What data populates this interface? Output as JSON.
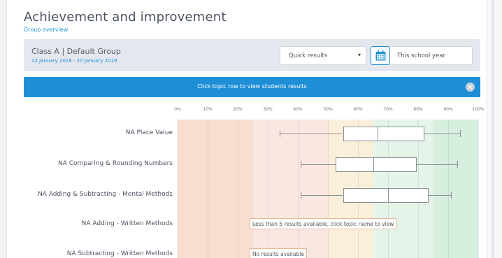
{
  "page": {
    "title": "Achievement and improvement",
    "subtitle": "Group overview"
  },
  "class_panel": {
    "name": "Class A | Default Group",
    "dates": "22 January 2018 - 20 January 2019",
    "quick_select": {
      "value": "Quick results",
      "caret": "▾"
    },
    "calendar_icon": "calendar-icon",
    "period_value": "This school year"
  },
  "banner": {
    "text": "Click topic row to view students results",
    "close_icon": "close-icon"
  },
  "chart_data": {
    "type": "box",
    "x_axis": {
      "range": [
        0,
        100
      ],
      "ticks": [
        "0%",
        "10%",
        "20%",
        "30%",
        "40%",
        "50%",
        "60%",
        "70%",
        "80%",
        "90%",
        "100%"
      ]
    },
    "zones": [
      {
        "from": 0,
        "to": 25,
        "color": "#f8ddd1"
      },
      {
        "from": 25,
        "to": 50,
        "color": "#fbe7e2"
      },
      {
        "from": 50,
        "to": 65,
        "color": "#fcefd9"
      },
      {
        "from": 65,
        "to": 85,
        "color": "#e4f4e8"
      },
      {
        "from": 85,
        "to": 100,
        "color": "#d6efdf"
      }
    ],
    "rows": [
      {
        "label": "NA Place Value",
        "min": 34,
        "q1": 55,
        "median": 66.5,
        "q3": 82,
        "max": 94
      },
      {
        "label": "NA Comparing & Rounding Numbers",
        "min": 41,
        "q1": 52.5,
        "median": 65,
        "q3": 79.5,
        "max": 93
      },
      {
        "label": "NA Adding & Subtracting - Mental Methods",
        "min": 41,
        "q1": 55,
        "median": 70,
        "q3": 83.5,
        "max": 91
      },
      {
        "label": "NA Adding - Written Methods",
        "note": "Less than 5 results available, click topic name to view"
      },
      {
        "label": "NA Subtracting - Written Methods",
        "note": "No results available"
      }
    ]
  }
}
